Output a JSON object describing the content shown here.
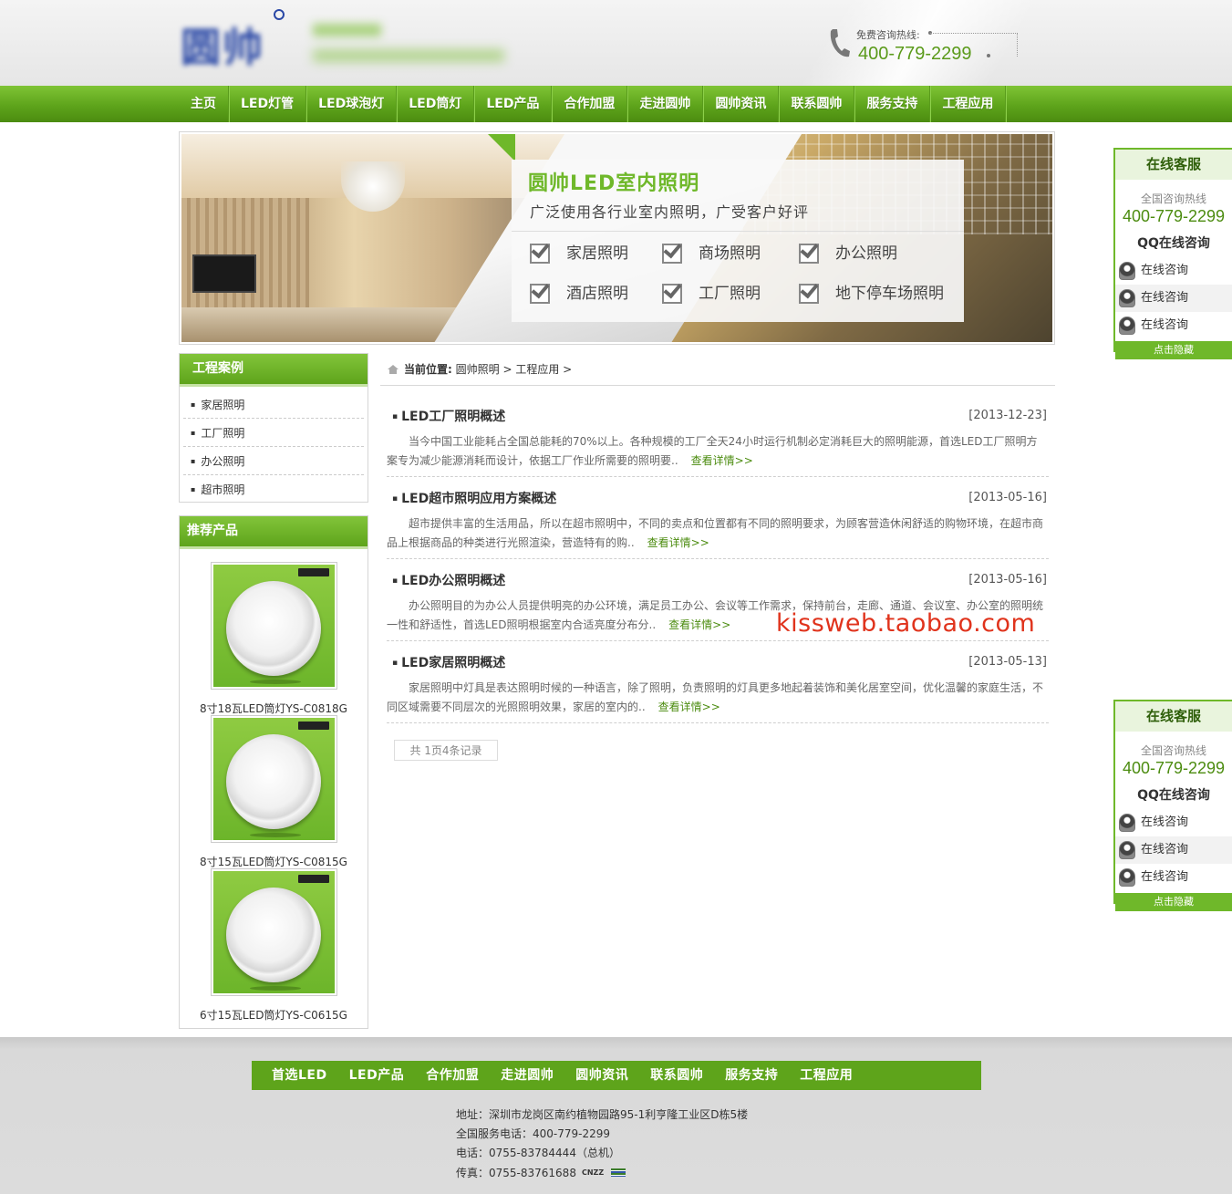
{
  "header": {
    "logo_text": "圆帅",
    "hotline_label": "免费咨询热线:",
    "hotline_number": "400-779-2299"
  },
  "nav": {
    "items": [
      "主页",
      "LED灯管",
      "LED球泡灯",
      "LED筒灯",
      "LED产品",
      "合作加盟",
      "走进圆帅",
      "圆帅资讯",
      "联系圆帅",
      "服务支持",
      "工程应用"
    ]
  },
  "banner": {
    "title": "圆帅LED室内照明",
    "subtitle": "广泛使用各行业室内照明，广受客户好评",
    "features": [
      "家居照明",
      "商场照明",
      "办公照明",
      "酒店照明",
      "工厂照明",
      "地下停车场照明"
    ]
  },
  "sidebar": {
    "cases_title": "工程案例",
    "cases": [
      "家居照明",
      "工厂照明",
      "办公照明",
      "超市照明"
    ],
    "products_title": "推荐产品",
    "products": [
      {
        "name": "8寸18瓦LED筒灯YS-C0818G"
      },
      {
        "name": "8寸15瓦LED筒灯YS-C0815G"
      },
      {
        "name": "6寸15瓦LED筒灯YS-C0615G"
      }
    ]
  },
  "breadcrumb": {
    "label": "当前位置:",
    "path": "圆帅照明 > 工程应用 >"
  },
  "articles": [
    {
      "title": "LED工厂照明概述",
      "date": "[2013-12-23]",
      "summary": "当今中国工业能耗占全国总能耗的70%以上。各种规模的工厂全天24小时运行机制必定消耗巨大的照明能源，首选LED工厂照明方案专为减少能源消耗而设计，依据工厂作业所需要的照明要..",
      "more": "查看详情>>"
    },
    {
      "title": "LED超市照明应用方案概述",
      "date": "[2013-05-16]",
      "summary": "超市提供丰富的生活用品，所以在超市照明中，不同的卖点和位置都有不同的照明要求，为顾客营造休闲舒适的购物环境，在超市商品上根据商品的种类进行光照渲染，营造特有的购..",
      "more": "查看详情>>"
    },
    {
      "title": "LED办公照明概述",
      "date": "[2013-05-16]",
      "summary": "办公照明目的为办公人员提供明亮的办公环境，满足员工办公、会议等工作需求，保持前台，走廊、通道、会议室、办公室的照明统一性和舒适性，首选LED照明根据室内合适亮度分布分..",
      "more": "查看详情>>"
    },
    {
      "title": "LED家居照明概述",
      "date": "[2013-05-13]",
      "summary": "家居照明中灯具是表达照明时候的一种语言，除了照明，负责照明的灯具更多地起着装饰和美化居室空间，优化温馨的家庭生活，不同区域需要不同层次的光照照明效果，家居的室内的..",
      "more": "查看详情>>"
    }
  ],
  "pager": "共 1页4条记录",
  "watermark": "kissweb.taobao.com",
  "service": {
    "title": "在线客服",
    "hotline_label": "全国咨询热线",
    "hotline_number": "400-779-2299",
    "qq_title": "QQ在线咨询",
    "items": [
      "在线咨询",
      "在线咨询",
      "在线咨询"
    ],
    "hide_label": "点击隐藏"
  },
  "footer": {
    "nav": [
      "首选LED",
      "LED产品",
      "合作加盟",
      "走进圆帅",
      "圆帅资讯",
      "联系圆帅",
      "服务支持",
      "工程应用"
    ],
    "address": "地址：深圳市龙岗区南约植物园路95-1利亨隆工业区D栋5楼",
    "service_phone": "全国服务电话：400-779-2299",
    "phone": "电话：0755-83784444（总机）",
    "fax": "传真：0755-83761688",
    "cnzz": "CNZZ"
  }
}
